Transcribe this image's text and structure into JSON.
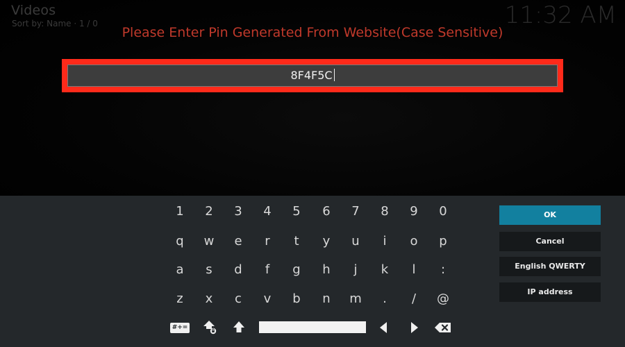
{
  "header": {
    "title": "Videos",
    "sort_info": "Sort by: Name  ·  1 / 0",
    "clock": "11:32 AM"
  },
  "dialog": {
    "prompt": "Please Enter Pin Generated From Website(Case Sensitive)",
    "pin_value": "8F4F5C"
  },
  "keyboard": {
    "row1": [
      "1",
      "2",
      "3",
      "4",
      "5",
      "6",
      "7",
      "8",
      "9",
      "0"
    ],
    "row2": [
      "q",
      "w",
      "e",
      "r",
      "t",
      "y",
      "u",
      "i",
      "o",
      "p"
    ],
    "row3": [
      "a",
      "s",
      "d",
      "f",
      "g",
      "h",
      "j",
      "k",
      "l",
      ":"
    ],
    "row4": [
      "z",
      "x",
      "c",
      "v",
      "b",
      "n",
      "m",
      ".",
      "/",
      "@"
    ],
    "symbols_label": "#+="
  },
  "buttons": {
    "ok": "OK",
    "cancel": "Cancel",
    "layout": "English QWERTY",
    "ip_address": "IP address"
  },
  "colors": {
    "accent": "#12809f",
    "highlight_frame": "#ff2a1a",
    "prompt_text": "#c0392b",
    "panel": "#24282b"
  }
}
